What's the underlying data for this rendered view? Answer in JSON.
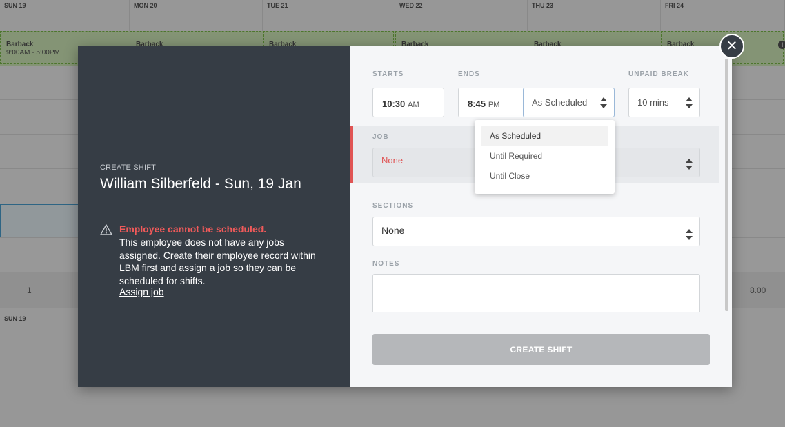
{
  "schedule": {
    "days": [
      "SUN 19",
      "MON 20",
      "TUE 21",
      "WED 22",
      "THU 23",
      "FRI 24"
    ],
    "shift": {
      "role": "Barback",
      "time": "9:00AM - 5:00PM",
      "role_short": "Barback"
    },
    "totals": {
      "left": "1",
      "right": "8.00"
    },
    "footer_day": "SUN 19",
    "info_icon": "info-icon"
  },
  "modal": {
    "close_icon": "close-icon",
    "left": {
      "label": "CREATE SHIFT",
      "title": "William Silberfeld - Sun, 19 Jan",
      "warning_icon": "warning-triangle-icon",
      "warning_title": "Employee cannot be scheduled.",
      "warning_body": "This employee does not have any jobs assigned. Create their employee record within LBM first and assign a job so they can be scheduled for shifts.",
      "warning_link": "Assign job"
    },
    "form": {
      "starts_label": "STARTS",
      "starts_time": "10:30",
      "starts_ampm": "AM",
      "ends_label": "ENDS",
      "ends_time": "8:45",
      "ends_ampm": "PM",
      "ends_mode": "As Scheduled",
      "unpaid_break_label": "UNPAID BREAK",
      "unpaid_break_value": "10 mins",
      "job_label": "JOB",
      "job_value": "None",
      "sections_label": "SECTIONS",
      "sections_value": "None",
      "notes_label": "NOTES",
      "notes_value": "",
      "ends_mode_options": [
        "As Scheduled",
        "Until Required",
        "Until Close"
      ],
      "ends_mode_selected": "As Scheduled",
      "submit_label": "CREATE SHIFT"
    }
  },
  "colors": {
    "panel_dark": "#363d45",
    "error": "#f05a5a",
    "disabled_button": "#b5b7ba"
  }
}
